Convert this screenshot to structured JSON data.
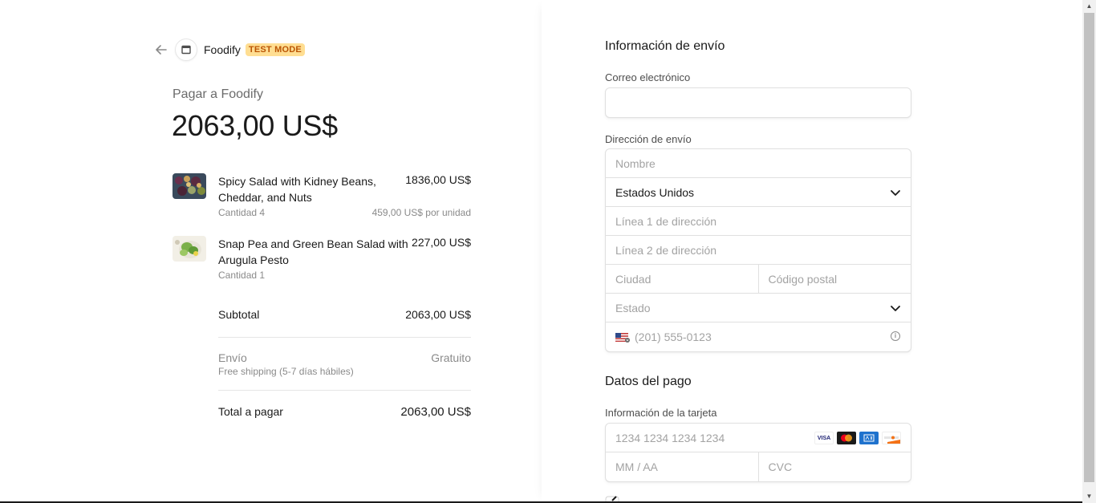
{
  "header": {
    "merchant": "Foodify",
    "badge": "TEST MODE"
  },
  "summary": {
    "pay_to": "Pagar a Foodify",
    "amount": "2063,00 US$",
    "items": [
      {
        "name": "Spicy Salad with Kidney Beans, Cheddar, and Nuts",
        "price": "1836,00 US$",
        "quantity": "Cantidad 4",
        "unit_price": "459,00 US$ por unidad"
      },
      {
        "name": "Snap Pea and Green Bean Salad with Arugula Pesto",
        "price": "227,00 US$",
        "quantity": "Cantidad 1",
        "unit_price": ""
      }
    ],
    "subtotal_label": "Subtotal",
    "subtotal_value": "2063,00 US$",
    "shipping_label": "Envío",
    "shipping_value": "Gratuito",
    "shipping_note": "Free shipping (5-7 días hábiles)",
    "total_label": "Total a pagar",
    "total_value": "2063,00 US$"
  },
  "shipping_form": {
    "title": "Información de envío",
    "email_label": "Correo electrónico",
    "email_value": "",
    "address_label": "Dirección de envío",
    "name_placeholder": "Nombre",
    "country_value": "Estados Unidos",
    "line1_placeholder": "Línea 1 de dirección",
    "line2_placeholder": "Línea 2 de dirección",
    "city_placeholder": "Ciudad",
    "postal_placeholder": "Código postal",
    "state_placeholder": "Estado",
    "phone_placeholder": "(201) 555-0123"
  },
  "payment_form": {
    "title": "Datos del pago",
    "card_label": "Información de la tarjeta",
    "card_placeholder": "1234 1234 1234 1234",
    "expiry_placeholder": "MM / AA",
    "cvc_placeholder": "CVC",
    "brands": [
      "VISA",
      "mastercard",
      "AMEX",
      "DISCOVER"
    ]
  },
  "colors": {
    "badge_bg": "#ffde92",
    "badge_text": "#bb5504",
    "text": "#1a1a1a",
    "muted": "#8a8a8a",
    "border": "#e0e0e0"
  }
}
